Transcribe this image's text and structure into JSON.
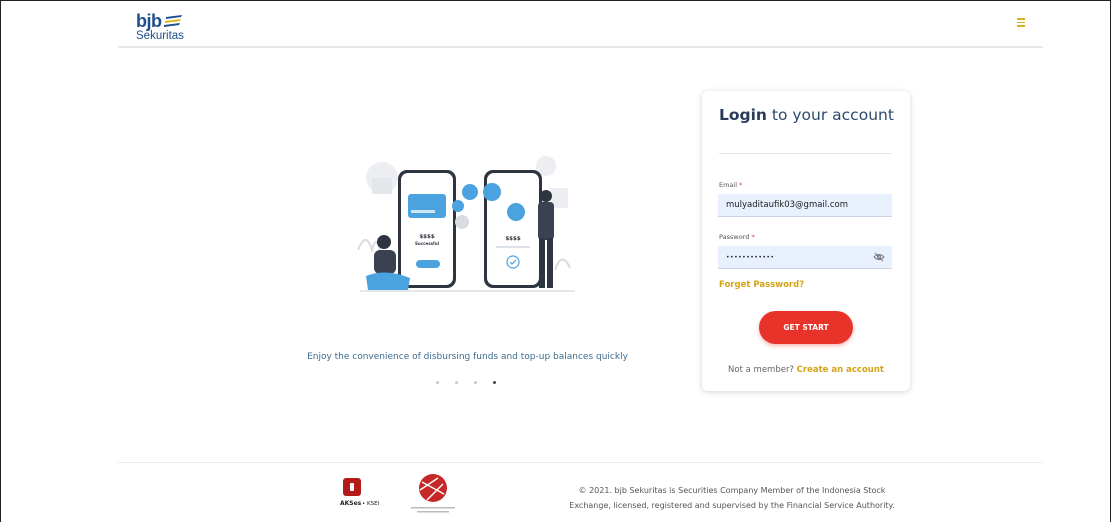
{
  "header": {
    "logo_main": "bjb",
    "logo_sub": "Sekuritas",
    "menu_icon": "hamburger-icon",
    "accent_color": "#d9b21f"
  },
  "carousel": {
    "caption": "Enjoy the convenience of disbursing funds and top-up balances quickly",
    "slide_count": 4,
    "active_slide": 4,
    "illustration": {
      "left_phone_amount": "$$$$",
      "left_phone_status": "Successful",
      "right_phone_amount": "$$$$"
    }
  },
  "login": {
    "title_bold": "Login",
    "title_rest": " to your account",
    "email_label": "Email",
    "email_value": "mulyaditaufik03@gmail.com",
    "password_label": "Password",
    "password_value": "••••••••••••",
    "required_mark": "*",
    "forgot_label": "Forget Password?",
    "submit_label": "GET START",
    "member_prefix": "Not a member? ",
    "create_account_label": "Create an account",
    "cta_color": "#e8332a",
    "link_color": "#d4a417"
  },
  "footer": {
    "aks_label": "AKSes",
    "ksei_label": "• KSEI",
    "copyright_line1": "© 2021. bjb Sekuritas is Securities Company Member of the Indonesia Stock",
    "copyright_line2": "Exchange, licensed, registered and supervised by the Financial Service Authority."
  }
}
